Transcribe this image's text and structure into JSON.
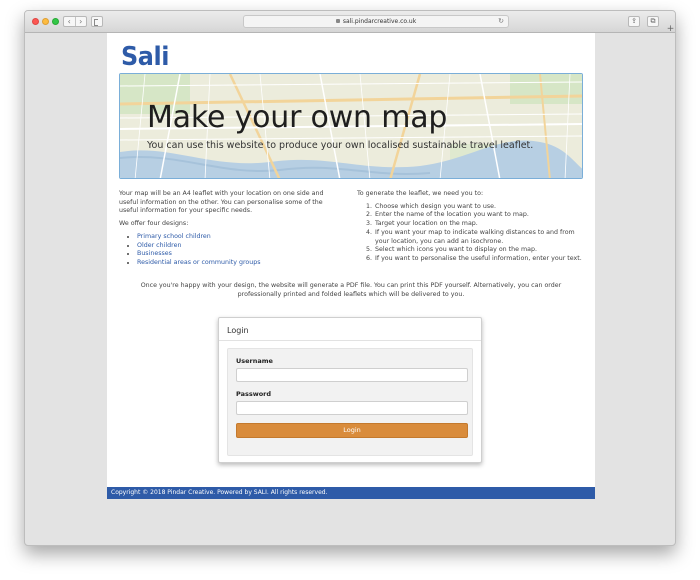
{
  "browser": {
    "url": "sali.pindarcreative.co.uk",
    "back_glyph": "‹",
    "forward_glyph": "›",
    "reload_glyph": "↻",
    "share_glyph": "⇪",
    "tabs_glyph": "⧉",
    "new_tab_glyph": "+"
  },
  "site": {
    "logo_text": "Sali",
    "brand_color": "#2e5ba8",
    "accent_color": "#d98c3c"
  },
  "hero": {
    "title": "Make your own map",
    "subtitle": "You can use this website to produce your own localised sustainable travel leaflet."
  },
  "intro": {
    "paragraph": "Your map will be an A4 leaflet with your location on one side and useful information on the other. You can personalise some of the useful information for your specific needs.",
    "designs_heading": "We offer four designs:",
    "designs": [
      "Primary school children",
      "Older children",
      "Businesses",
      "Residential areas or community groups"
    ]
  },
  "steps": {
    "heading": "To generate the leaflet, we need you to:",
    "items": [
      "Choose which design you want to use.",
      "Enter the name of the location you want to map.",
      "Target your location on the map.",
      "If you want your map to indicate walking distances to and from your location, you can add an isochrone.",
      "Select which icons you want to display on the map.",
      "If you want to personalise the useful information, enter your text."
    ]
  },
  "note": "Once you're happy with your design, the website will generate a PDF file. You can print this PDF yourself. Alternatively, you can order professionally printed and folded leaflets which will be delivered to you.",
  "login": {
    "heading": "Login",
    "username_label": "Username",
    "username_value": "",
    "password_label": "Password",
    "password_value": "",
    "button_label": "Login"
  },
  "footer": {
    "text": "Copyright © 2018 Pindar Creative. Powered by SALI. All rights reserved."
  }
}
